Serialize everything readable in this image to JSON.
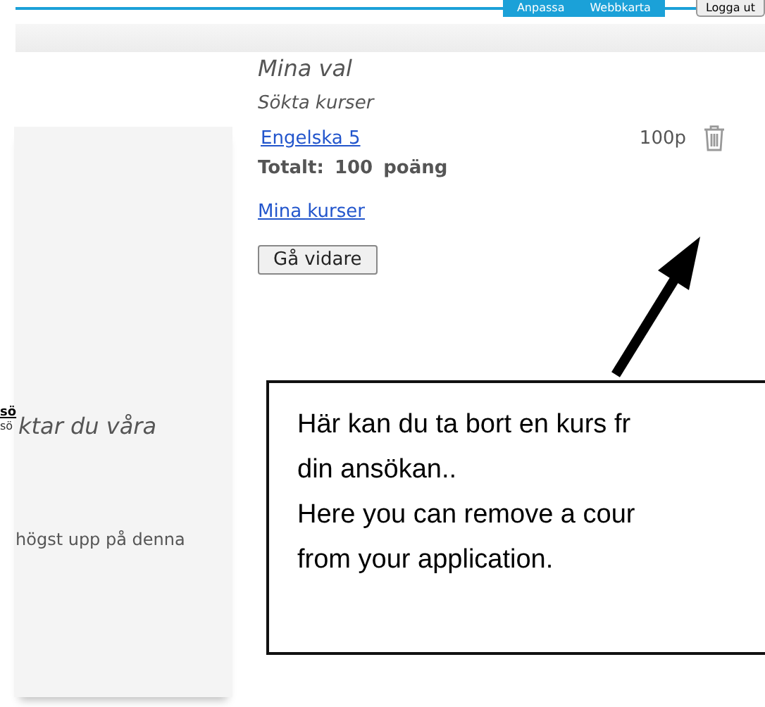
{
  "top_nav": {
    "tabs": [
      {
        "label": "Anpassa"
      },
      {
        "label": "Webbkarta"
      }
    ],
    "logout_button": "Logga ut"
  },
  "side_panel": {
    "cut_link": "sö",
    "cut_text": "sö",
    "texts": [
      "ktar du våra",
      "högst upp på denna"
    ]
  },
  "selection": {
    "title": "Mina val",
    "subtitle": "Sökta kurser",
    "courses": [
      {
        "name": "Engelska 5",
        "points": "100p"
      }
    ],
    "total": "Totalt: 100 poäng",
    "my_courses_link": "Mina kurser",
    "continue_button": "Gå vidare"
  },
  "callout": {
    "lines": [
      "Här kan du ta bort en kurs fr",
      "din ansökan..",
      "Here you can remove a cour",
      "from your application."
    ]
  }
}
